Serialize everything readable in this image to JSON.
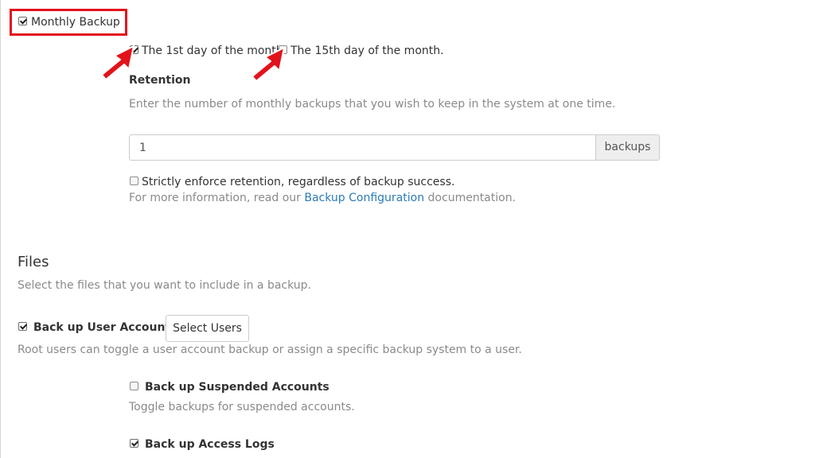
{
  "monthly": {
    "label": "Monthly Backup",
    "checked": true,
    "day_1st_label": "The 1st day of the month.",
    "day_1st_checked": true,
    "day_15th_label": "The 15th day of the month.",
    "day_15th_checked": false,
    "retention_heading": "Retention",
    "retention_help": "Enter the number of monthly backups that you wish to keep in the system at one time.",
    "retention_value": "1",
    "retention_unit": "backups",
    "strict_label": "Strictly enforce retention, regardless of backup success.",
    "strict_checked": false,
    "info_prefix": "For more information, read our ",
    "info_link": "Backup Configuration",
    "info_suffix": " documentation."
  },
  "files": {
    "title": "Files",
    "subtitle": "Select the files that you want to include in a backup.",
    "user_accounts_label": "Back up User Accounts",
    "user_accounts_checked": true,
    "select_users_button": "Select Users",
    "user_accounts_help": "Root users can toggle a user account backup or assign a specific backup system to a user.",
    "suspended_label": "Back up Suspended Accounts",
    "suspended_checked": false,
    "suspended_help": "Toggle backups for suspended accounts.",
    "access_logs_label": "Back up Access Logs",
    "access_logs_checked": true
  },
  "colors": {
    "highlight": "#e1131b",
    "link": "#2a7ab8",
    "muted_text": "#8a8a8a"
  },
  "annotations": [
    "red-arrow-icon",
    "red-arrow-icon"
  ]
}
